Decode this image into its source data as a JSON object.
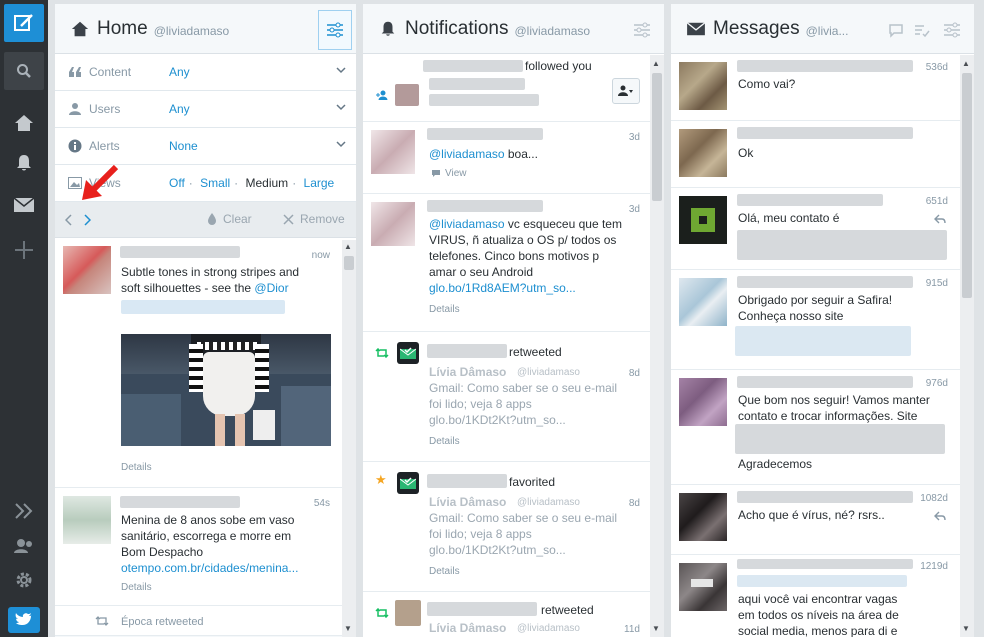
{
  "app": {
    "accent": "#1e8fd6",
    "nav_icons": [
      "compose-icon",
      "search-icon",
      "home-icon",
      "notifications-icon",
      "messages-icon",
      "add-column-icon",
      "expand-icon",
      "accounts-icon",
      "settings-icon",
      "twitter-icon"
    ]
  },
  "home": {
    "col_num": "1",
    "title": "Home",
    "handle": "@liviadamaso",
    "filters": [
      {
        "label": "Content",
        "value": "Any"
      },
      {
        "label": "Users",
        "value": "Any"
      },
      {
        "label": "Alerts",
        "value": "None"
      }
    ],
    "media": {
      "label": "Views",
      "off": "Off",
      "small": "Small",
      "medium": "Medium",
      "large": "Large"
    },
    "toolbar": {
      "clear": "Clear",
      "remove": "Remove"
    },
    "items": [
      {
        "time": "now",
        "text1": "Subtle tones in strong stripes and",
        "text2": "soft silhouettes - see the ",
        "mention": "@Dior",
        "details": "Details"
      },
      {
        "time": "54s",
        "text1": "Menina de 8 anos sobe em vaso",
        "text2": "sanitário, escorrega e morre em",
        "text3": "Bom Despacho",
        "link": "otempo.com.br/cidades/menina...",
        "details": "Details"
      },
      {
        "retweet": "Época retweeted"
      }
    ]
  },
  "notifications": {
    "col_num": "2",
    "title": "Notifications",
    "handle": "@liviadamaso",
    "items": [
      {
        "action": "followed you"
      },
      {
        "time": "3d",
        "mention": "@liviadamaso",
        "text": " boa...",
        "view": "View"
      },
      {
        "time": "3d",
        "mention": "@liviadamaso",
        "text1": " vc esqueceu que tem",
        "text2": "VIRUS, ñ atualiza o OS p/ todos os",
        "text3": "telefones. Cinco bons motivos p",
        "text4": "amar o seu Android",
        "link": "glo.bo/1Rd8AEM?utm_so...",
        "details": "Details"
      },
      {
        "action": "retweeted",
        "name": "Lívia Dâmaso",
        "handle": "@liviadamaso",
        "time": "8d",
        "text1": "Gmail: Como saber se o seu e-mail",
        "text2": "foi lido; veja 8 apps",
        "text3": "glo.bo/1KDt2Kt?utm_so...",
        "details": "Details"
      },
      {
        "action": "favorited",
        "name": "Lívia Dâmaso",
        "handle": "@liviadamaso",
        "time": "8d",
        "text1": "Gmail: Como saber se o seu e-mail",
        "text2": "foi lido; veja 8 apps",
        "text3": "glo.bo/1KDt2Kt?utm_so...",
        "details": "Details"
      },
      {
        "action": "retweeted",
        "name": "Lívia Dâmaso",
        "handle": "@liviadamaso",
        "time": "11d"
      }
    ]
  },
  "messages": {
    "col_num": "3",
    "title": "Messages",
    "handle": "@livia...",
    "items": [
      {
        "time": "536d",
        "text1": "Como vai?"
      },
      {
        "time": "",
        "text1": "Ok"
      },
      {
        "time": "651d",
        "text1": "Olá, meu contato é"
      },
      {
        "time": "915d",
        "text1": "Obrigado por seguir a Safira!",
        "text2": "Conheça nosso site"
      },
      {
        "time": "976d",
        "text1": "Que bom nos seguir! Vamos manter",
        "text2": "contato e trocar informações. Site",
        "text3": "Agradecemos"
      },
      {
        "time": "1082d",
        "text1": "Acho que é vírus, né? rsrs.."
      },
      {
        "time": "1219d",
        "text1": "aqui você vai encontrar vagas",
        "text2": "em todos os níveis na área de",
        "text3": "social media, menos para di e"
      }
    ]
  }
}
